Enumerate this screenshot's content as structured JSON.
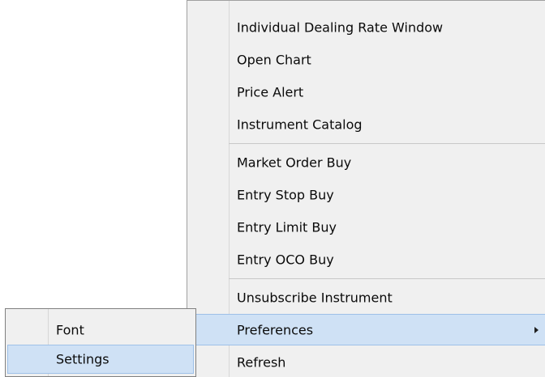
{
  "context_menu": {
    "items": [
      {
        "label": "Individual Dealing Rate Window"
      },
      {
        "label": "Open Chart"
      },
      {
        "label": "Price Alert"
      },
      {
        "label": "Instrument Catalog"
      },
      {
        "label": "Market Order Buy"
      },
      {
        "label": "Entry Stop Buy"
      },
      {
        "label": "Entry Limit Buy"
      },
      {
        "label": "Entry OCO Buy"
      },
      {
        "label": "Unsubscribe Instrument"
      },
      {
        "label": "Preferences",
        "has_submenu": true,
        "highlighted": true
      },
      {
        "label": "Refresh"
      }
    ]
  },
  "preferences_submenu": {
    "items": [
      {
        "label": "Font"
      },
      {
        "label": "Settings",
        "highlighted": true
      }
    ]
  },
  "colors": {
    "menu_background": "#f0f0f0",
    "highlight_background": "#cfe1f5",
    "highlight_border": "#9ec0e8"
  }
}
